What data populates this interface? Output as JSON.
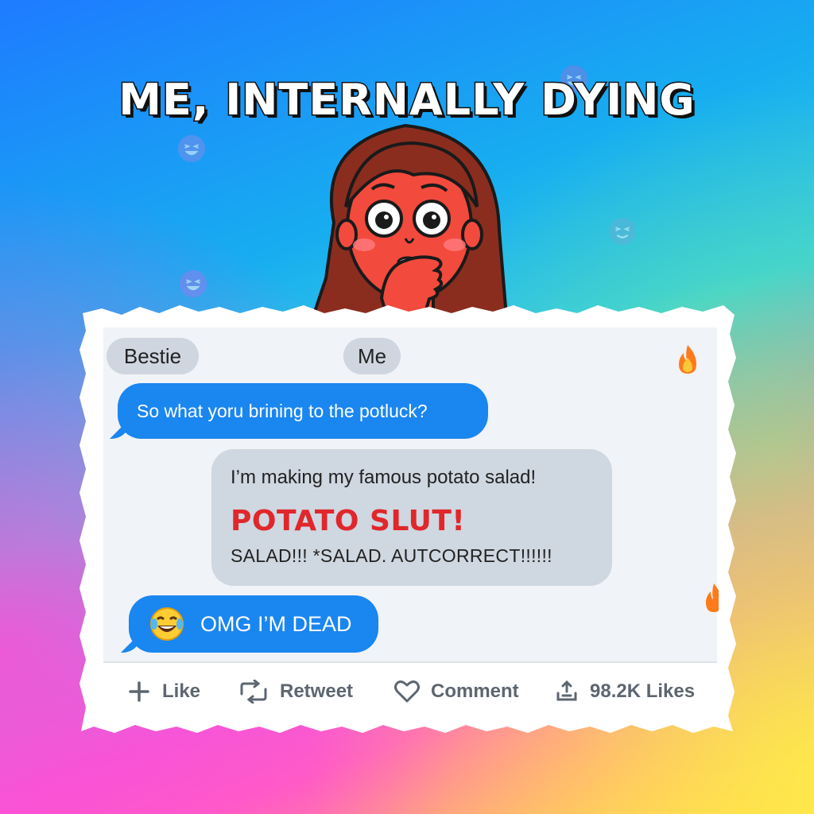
{
  "meme": {
    "title": "ME, INTERNALLY DYING"
  },
  "chat": {
    "participants": [
      "Bestie",
      "Me"
    ],
    "messages": [
      {
        "text": "So what yoru brining to the potluck?",
        "style": "blue-left"
      },
      {
        "lines": [
          "I’m making my famous potato salad!",
          "POTATO SLUT!",
          "SALAD!!! *SALAD. AUTCORRECT!!!!!!"
        ],
        "style": "gray-right"
      },
      {
        "text": "OMG I’M DEAD",
        "icon": "face-with-tears-of-joy-icon",
        "style": "blue-left"
      }
    ]
  },
  "actions": {
    "like_label": "Like",
    "retweet_label": "Retweet",
    "comment_label": "Comment",
    "likes_count": "98.2K Likes"
  },
  "icons": [
    "plus-icon",
    "retweet-icon",
    "heart-icon",
    "share-icon",
    "fire-icon",
    "laughing-emoji-icon"
  ],
  "colors": {
    "bubble_blue": "#1a86f0",
    "bubble_gray": "#cfd7e1",
    "highlight_red": "#e0272b",
    "action_gray": "#5d6670"
  }
}
